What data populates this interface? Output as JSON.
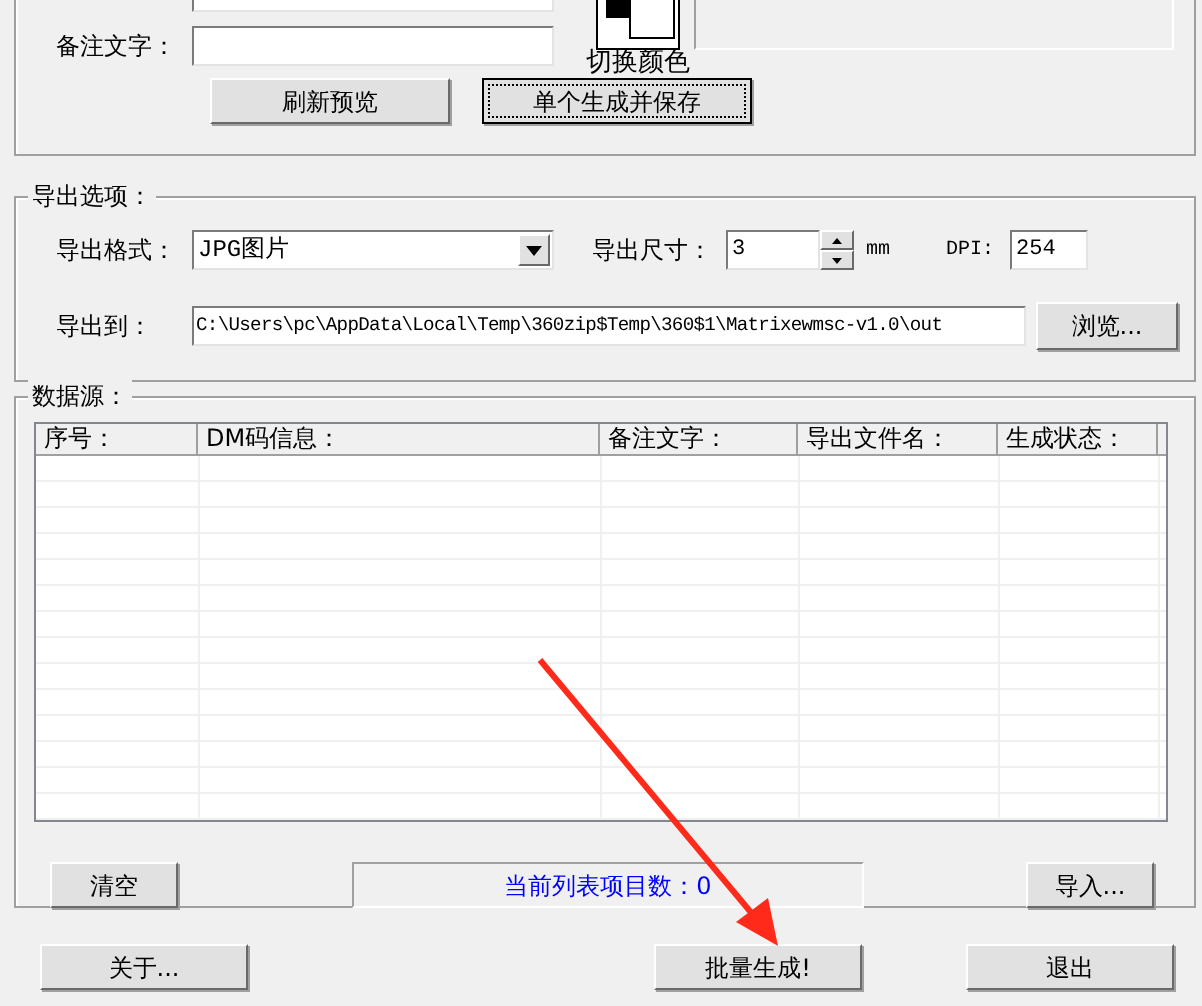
{
  "top_group": {
    "note_label": "备注文字：",
    "color_button": "切换颜色",
    "buttons": [
      {
        "label": "刷新预览",
        "focused": false
      },
      {
        "label": "单个生成并保存",
        "focused": true
      }
    ]
  },
  "export_options": {
    "title": "导出选项：",
    "format_label": "导出格式：",
    "format_value": "JPG图片",
    "size_label": "导出尺寸：",
    "size_value": "3",
    "size_unit": "mm",
    "dpi_label": "DPI:",
    "dpi_value": "254",
    "path_label": "导出到：",
    "path_value": "C:\\Users\\pc\\AppData\\Local\\Temp\\360zip$Temp\\360$1\\Matrixewmsc-v1.0\\out",
    "browse_button": "浏览..."
  },
  "data_source": {
    "title": "数据源：",
    "table": {
      "columns": [
        "序号：",
        "DM码信息：",
        "备注文字：",
        "导出文件名：",
        "生成状态："
      ]
    },
    "clear_button": "清空",
    "count_status": "当前列表项目数：0",
    "import_button": "导入..."
  },
  "footer_buttons": [
    "关于...",
    "批量生成!",
    "退出"
  ]
}
